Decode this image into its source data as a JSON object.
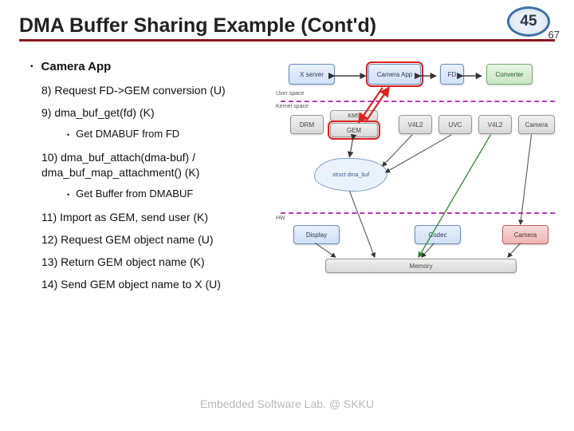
{
  "page": {
    "current": "45",
    "total": "67"
  },
  "title": "DMA Buffer Sharing Example (Cont'd)",
  "section_heading": "Camera App",
  "steps": [
    "8) Request FD->GEM conversion (U)",
    "9) dma_buf_get(fd) (K)",
    "10) dma_buf_attach(dma-buf) / dma_buf_map_attachment() (K)",
    "11) Import as GEM, send user (K)",
    "12) Request GEM object name (U)",
    "13) Return GEM object name (K)",
    "14) Send GEM object name to X (U)"
  ],
  "substeps": {
    "after9": "Get DMABUF from FD",
    "after10": "Get Buffer from DMABUF"
  },
  "diagram": {
    "user_space_label": "User space",
    "kernel_space_label": "Kernel space",
    "hw_label": "HW",
    "top": {
      "xserver": "X server",
      "camera_app": "Camera App",
      "fd": "FD",
      "converter": "Converter"
    },
    "mid": {
      "drm": "DRM",
      "kms": "KMS",
      "gem": "GEM",
      "v4l2_a": "V4L2",
      "uvc": "UVC",
      "v4l2_b": "V4L2",
      "cam_drv": "Camera"
    },
    "cloud": "struct dma_buf",
    "bottom": {
      "display": "Display",
      "codec": "Codec",
      "camera": "Camera"
    },
    "memory": "Memory"
  },
  "footer": "Embedded Software Lab. @ SKKU"
}
